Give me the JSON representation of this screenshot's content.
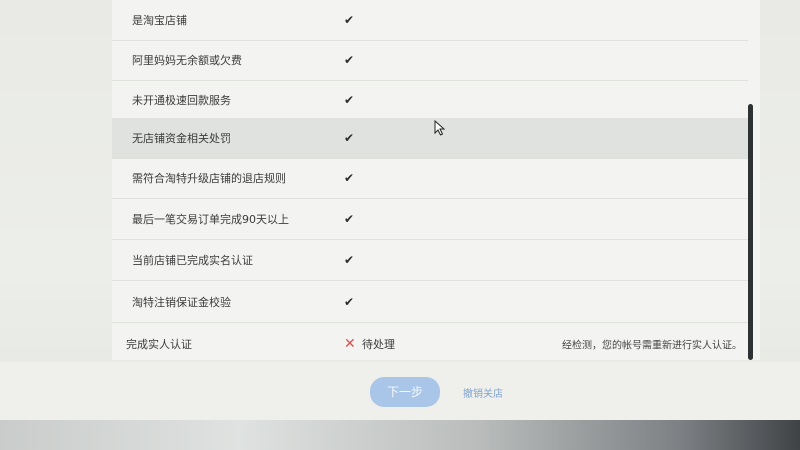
{
  "checklist": {
    "rows": [
      {
        "label": "是淘宝店铺",
        "mark": "✔"
      },
      {
        "label": "阿里妈妈无余额或欠费",
        "mark": "✔"
      },
      {
        "label": "未开通极速回款服务",
        "mark": "✔"
      },
      {
        "label": "无店铺资金相关处罚",
        "mark": "✔"
      },
      {
        "label": "需符合淘特升级店铺的退店规则",
        "mark": "✔"
      },
      {
        "label": "最后一笔交易订单完成90天以上",
        "mark": "✔"
      },
      {
        "label": "当前店铺已完成实名认证",
        "mark": "✔"
      },
      {
        "label": "淘特注销保证金校验",
        "mark": "✔"
      }
    ],
    "pending_row": {
      "label": "完成实人认证",
      "mark": "✕",
      "status": "待处理",
      "note": "经检测，您的帐号需重新进行实人认证。"
    }
  },
  "footer": {
    "next_label": "下一步",
    "cancel_label": "撤销关店"
  }
}
